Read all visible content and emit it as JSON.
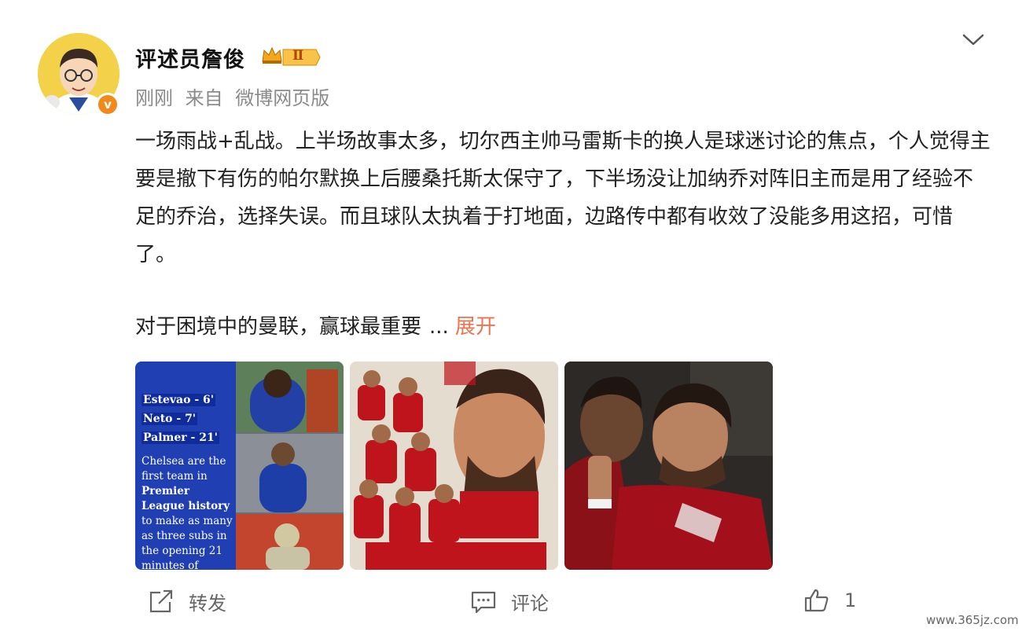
{
  "author": {
    "name": "评述员詹俊",
    "avatar_icon": "cartoon-avatar",
    "verified_badge": "v",
    "level": "Ⅱ"
  },
  "meta": {
    "time": "刚刚",
    "source_prefix": "来自",
    "source": "微博网页版"
  },
  "post": {
    "text_main": "一场雨战+乱战。上半场故事太多，切尔西主帅马雷斯卡的换人是球迷讨论的焦点，个人觉得主要是撤下有伤的帕尔默换上后腰桑托斯太保守了，下半场没让加纳乔对阵旧主而是用了经验不足的乔治，选择失误。而且球队太执着于打地面，边路传中都有收效了没能多用这招，可惜了。",
    "text_second": "对于困境中的曼联，赢球最重要",
    "ellipsis": "...",
    "expand_label": "展开"
  },
  "images": {
    "img1": {
      "subs": [
        "Estevao - 6'",
        "Neto - 7'",
        "Palmer - 21'"
      ],
      "caption_parts": [
        "Chelsea are the first team in ",
        "Premier League history",
        " to make as many as three subs in the opening 21 minutes of"
      ]
    }
  },
  "actions": {
    "repost_label": "转发",
    "comment_label": "评论",
    "like_count": "1"
  },
  "watermark": "www.365jz.com",
  "colors": {
    "accent": "#eb7350",
    "verified": "#f08a1b",
    "meta_gray": "#8a8a8a",
    "chelsea_blue": "#1f3fb3",
    "united_red": "#c0141c"
  }
}
